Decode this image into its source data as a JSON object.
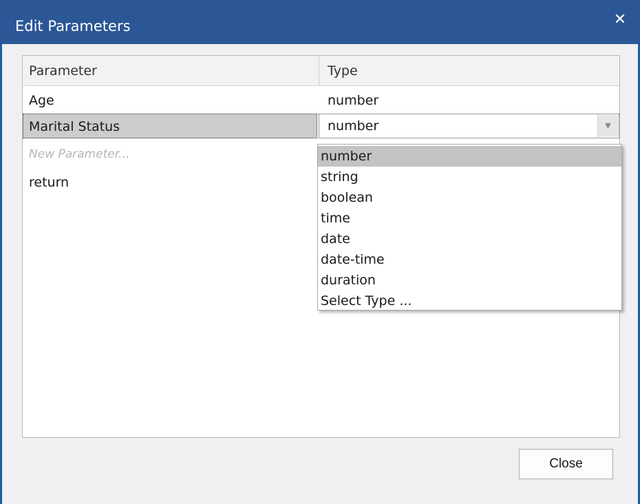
{
  "window": {
    "title": "Edit Parameters",
    "close_glyph": "✕"
  },
  "grid": {
    "columns": [
      "Parameter",
      "Type"
    ],
    "rows": [
      {
        "parameter": "Age",
        "type": "number"
      },
      {
        "parameter": "Marital Status",
        "type": "number"
      }
    ],
    "new_row_placeholder": "New Parameter...",
    "return_row": "return"
  },
  "type_combo": {
    "value": "number",
    "arrow_glyph": "▼",
    "options": [
      "number",
      "string",
      "boolean",
      "time",
      "date",
      "date-time",
      "duration",
      "Select Type ..."
    ],
    "highlighted_index": 0
  },
  "footer": {
    "close_label": "Close"
  },
  "colors": {
    "title_bar": "#2b5797",
    "window_bg": "#f0f0f0",
    "selection": "#cccccc",
    "highlight": "#c3c3c3"
  }
}
